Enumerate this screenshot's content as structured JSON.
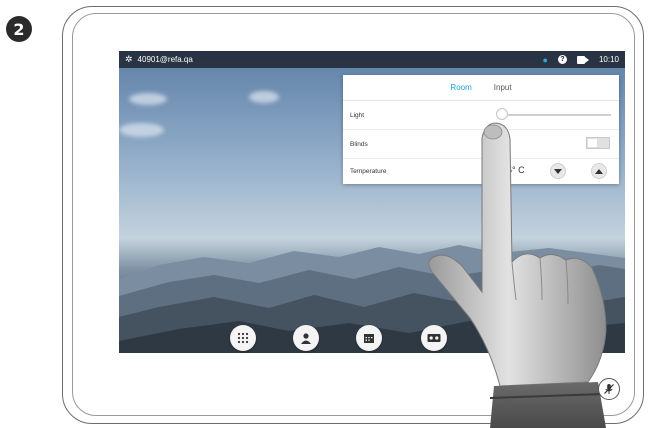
{
  "step": {
    "number": "2"
  },
  "status_bar": {
    "settings_icon": "gear-icon",
    "uri": "40901@refa.qa",
    "proximity_icon": "proximity-pin-icon",
    "help_label": "?",
    "camera_icon": "camera-self-view-icon",
    "time": "10:10"
  },
  "panel": {
    "tabs": [
      {
        "label": "Room",
        "active": true
      },
      {
        "label": "Input",
        "active": false
      }
    ],
    "rows": {
      "light": {
        "label": "Light",
        "level": 0
      },
      "blinds": {
        "label": "Blinds",
        "on": false
      },
      "temperature": {
        "label": "Temperature",
        "value": "5° C"
      }
    }
  },
  "bottom_bar": {
    "buttons": [
      {
        "icon": "keypad-icon"
      },
      {
        "icon": "contacts-icon"
      },
      {
        "icon": "calendar-icon"
      },
      {
        "icon": "voicemail-icon"
      }
    ]
  },
  "mute_icon": "microphone-muted-icon",
  "colors": {
    "accent": "#1fa0db",
    "status_bar": "#191e26"
  }
}
